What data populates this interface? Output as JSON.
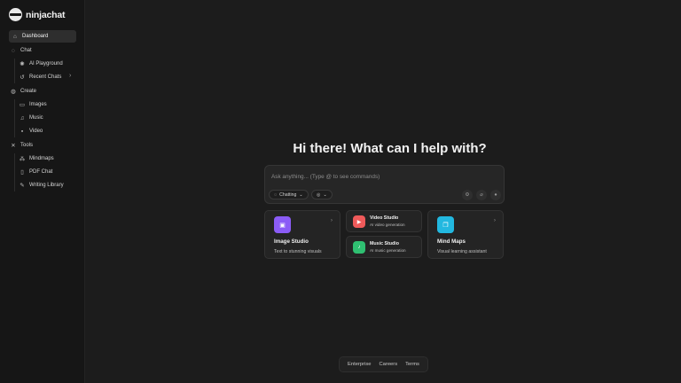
{
  "app": {
    "name": "ninjachat"
  },
  "sidebar": {
    "dashboard": "Dashboard",
    "chat": {
      "label": "Chat",
      "items": [
        "AI Playground",
        "Recent Chats"
      ]
    },
    "create": {
      "label": "Create",
      "items": [
        "Images",
        "Music",
        "Video"
      ]
    },
    "tools": {
      "label": "Tools",
      "items": [
        "Mindmaps",
        "PDF Chat",
        "Writing Library"
      ]
    }
  },
  "main": {
    "headline": "Hi there! What can I help with?",
    "prompt": {
      "placeholder": "Ask anything... (Type @ to see commands)",
      "mode": "Chatting"
    },
    "cards": {
      "image_studio": {
        "title": "Image Studio",
        "subtitle": "Text to stunning visuals"
      },
      "video_studio": {
        "title": "Video Studio",
        "subtitle": "AI video generation"
      },
      "music_studio": {
        "title": "Music Studio",
        "subtitle": "AI music generation"
      },
      "mind_maps": {
        "title": "Mind Maps",
        "subtitle": "Visual learning assistant"
      }
    }
  },
  "footer": {
    "links": [
      "Enterprise",
      "Careers",
      "Terms"
    ]
  },
  "colors": {
    "image_studio": "#8b5cf6",
    "video_studio": "#ef5a5a",
    "music_studio": "#2fbf71",
    "mind_maps": "#22b8e0"
  }
}
